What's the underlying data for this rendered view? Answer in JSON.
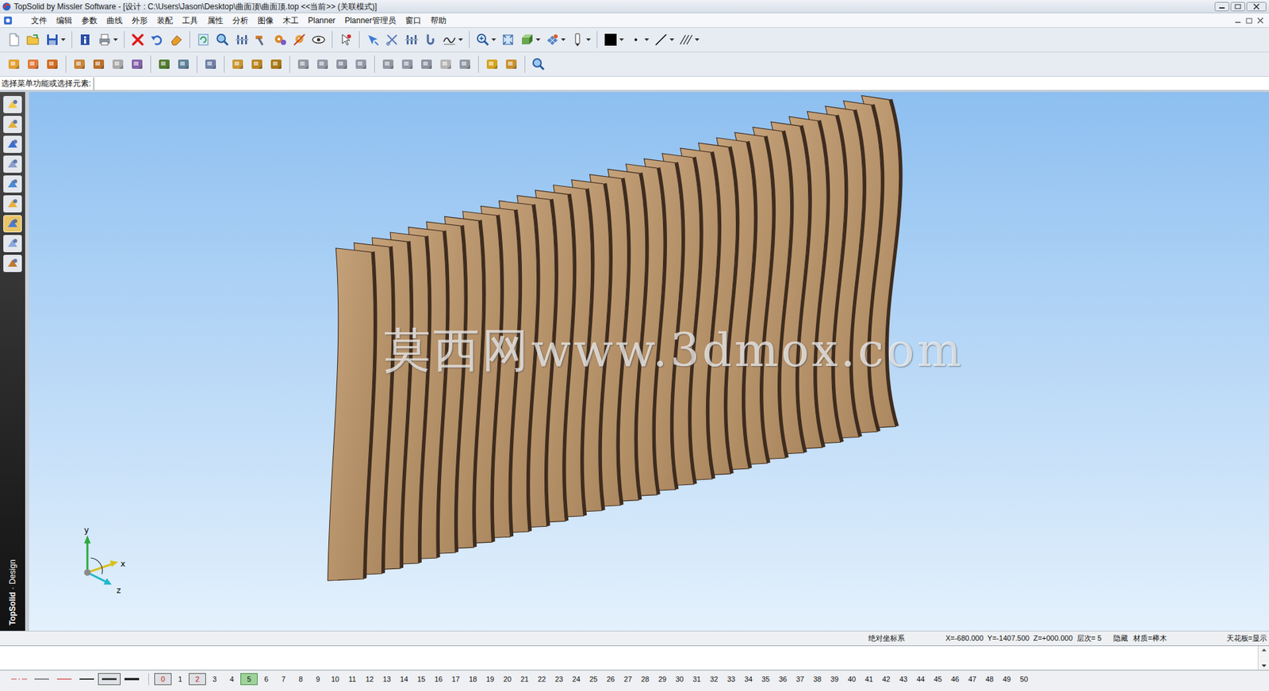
{
  "window": {
    "title": "TopSolid by Missler Software - [设计 : C:\\Users\\Jason\\Desktop\\曲面顶\\曲面顶.top  <<当前>> (关联模式)]"
  },
  "menu": [
    "文件",
    "编辑",
    "参数",
    "曲线",
    "外形",
    "装配",
    "工具",
    "属性",
    "分析",
    "图像",
    "木工",
    "Planner",
    "Planner管理员",
    "窗口",
    "帮助"
  ],
  "prompt": {
    "label": "选择菜单功能或选择元素:",
    "value": ""
  },
  "palette": [
    {
      "selected": false
    },
    {
      "selected": false
    },
    {
      "selected": false
    },
    {
      "selected": false
    },
    {
      "selected": false
    },
    {
      "selected": false
    },
    {
      "selected": true
    },
    {
      "selected": false
    },
    {
      "selected": false
    }
  ],
  "brand": {
    "name": "TopSolid",
    "separator": "·",
    "product": "Design"
  },
  "viewport": {
    "watermark": "莫西网www.3dmox.com",
    "axes": [
      "y",
      "x",
      "z"
    ]
  },
  "status_bar": {
    "coordinate_system": "绝对坐标系",
    "x": "X=-680.000",
    "y": "Y=-1407.500",
    "z": "Z=+000.000",
    "layer": "层次= 5",
    "hidden": "隐藏",
    "material": "材质=榉木",
    "ceiling": "天花板=显示"
  },
  "command_line": {
    "value": ""
  },
  "line_styles": [
    {
      "kind": "dashdot-red",
      "selected": false
    },
    {
      "kind": "thin",
      "selected": false
    },
    {
      "kind": "thin-red",
      "selected": false
    },
    {
      "kind": "medium",
      "selected": false
    },
    {
      "kind": "thick",
      "selected": true
    },
    {
      "kind": "thicker",
      "selected": false
    }
  ],
  "layers": [
    {
      "label": "0",
      "kind": "red-box"
    },
    {
      "label": "1",
      "kind": "plain"
    },
    {
      "label": "2",
      "kind": "red-box"
    },
    {
      "label": "3",
      "kind": "plain"
    },
    {
      "label": "4",
      "kind": "plain"
    },
    {
      "label": "5",
      "kind": "green-box"
    },
    {
      "label": "6",
      "kind": "plain"
    },
    {
      "label": "7",
      "kind": "plain"
    },
    {
      "label": "8",
      "kind": "plain"
    },
    {
      "label": "9",
      "kind": "plain"
    },
    {
      "label": "10",
      "kind": "plain"
    },
    {
      "label": "11",
      "kind": "plain"
    },
    {
      "label": "12",
      "kind": "plain"
    },
    {
      "label": "13",
      "kind": "plain"
    },
    {
      "label": "14",
      "kind": "plain"
    },
    {
      "label": "15",
      "kind": "plain"
    },
    {
      "label": "16",
      "kind": "plain"
    },
    {
      "label": "17",
      "kind": "plain"
    },
    {
      "label": "18",
      "kind": "plain"
    },
    {
      "label": "19",
      "kind": "plain"
    },
    {
      "label": "20",
      "kind": "plain"
    },
    {
      "label": "21",
      "kind": "plain"
    },
    {
      "label": "22",
      "kind": "plain"
    },
    {
      "label": "23",
      "kind": "plain"
    },
    {
      "label": "24",
      "kind": "plain"
    },
    {
      "label": "25",
      "kind": "plain"
    },
    {
      "label": "26",
      "kind": "plain"
    },
    {
      "label": "27",
      "kind": "plain"
    },
    {
      "label": "28",
      "kind": "plain"
    },
    {
      "label": "29",
      "kind": "plain"
    },
    {
      "label": "30",
      "kind": "plain"
    },
    {
      "label": "31",
      "kind": "plain"
    },
    {
      "label": "32",
      "kind": "plain"
    },
    {
      "label": "33",
      "kind": "plain"
    },
    {
      "label": "34",
      "kind": "plain"
    },
    {
      "label": "35",
      "kind": "plain"
    },
    {
      "label": "36",
      "kind": "plain"
    },
    {
      "label": "37",
      "kind": "plain"
    },
    {
      "label": "38",
      "kind": "plain"
    },
    {
      "label": "39",
      "kind": "plain"
    },
    {
      "label": "40",
      "kind": "plain"
    },
    {
      "label": "41",
      "kind": "plain"
    },
    {
      "label": "42",
      "kind": "plain"
    },
    {
      "label": "43",
      "kind": "plain"
    },
    {
      "label": "44",
      "kind": "plain"
    },
    {
      "label": "45",
      "kind": "plain"
    },
    {
      "label": "46",
      "kind": "plain"
    },
    {
      "label": "47",
      "kind": "plain"
    },
    {
      "label": "48",
      "kind": "plain"
    },
    {
      "label": "49",
      "kind": "plain"
    },
    {
      "label": "50",
      "kind": "plain"
    }
  ]
}
